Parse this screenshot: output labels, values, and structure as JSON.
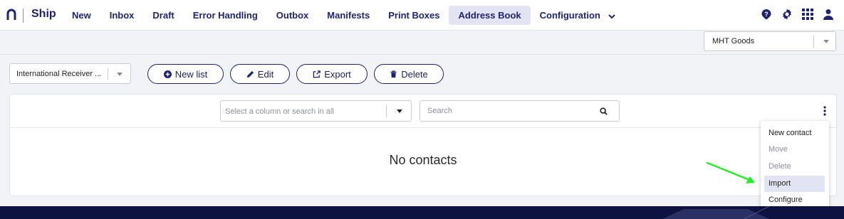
{
  "app": {
    "brand": "Ship"
  },
  "nav": {
    "items": [
      {
        "label": "New"
      },
      {
        "label": "Inbox"
      },
      {
        "label": "Draft"
      },
      {
        "label": "Error Handling"
      },
      {
        "label": "Outbox"
      },
      {
        "label": "Manifests"
      },
      {
        "label": "Print Boxes"
      },
      {
        "label": "Address Book",
        "active": true
      },
      {
        "label": "Configuration",
        "has_dropdown": true
      }
    ]
  },
  "header_icons": [
    "help-icon",
    "gear-icon",
    "apps-grid-icon",
    "user-icon"
  ],
  "account_select": {
    "value": "MHT Goods"
  },
  "list_select": {
    "value": "International Receiver ..."
  },
  "toolbar": {
    "new_list_label": "New list",
    "edit_label": "Edit",
    "export_label": "Export",
    "delete_label": "Delete"
  },
  "filter": {
    "column_placeholder": "Select a column or search in all",
    "search_placeholder": "Search"
  },
  "empty_state": {
    "message": "No contacts"
  },
  "context_menu": {
    "items": [
      {
        "label": "New contact",
        "disabled": false
      },
      {
        "label": "Move",
        "disabled": true
      },
      {
        "label": "Delete",
        "disabled": true
      },
      {
        "label": "Import",
        "disabled": false,
        "highlighted": true
      },
      {
        "label": "Configure",
        "disabled": false
      }
    ]
  },
  "colors": {
    "primary": "#1f236e",
    "active_nav_bg": "#e2e4f3",
    "annotation_arrow": "#22ee22",
    "footer": "#0e1240"
  }
}
